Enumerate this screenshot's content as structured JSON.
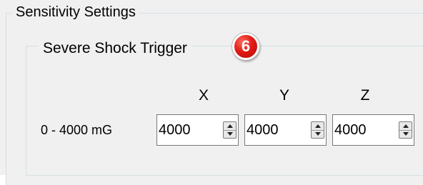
{
  "outer_group": {
    "title": "Sensitivity Settings"
  },
  "inner_group": {
    "title": "Severe Shock Trigger",
    "badge": "6"
  },
  "axes": [
    "X",
    "Y",
    "Z"
  ],
  "range_label": "0 - 4000 mG",
  "fields": [
    {
      "axis": "X",
      "value": "4000"
    },
    {
      "axis": "Y",
      "value": "4000"
    },
    {
      "axis": "Z",
      "value": "4000"
    }
  ],
  "colors": {
    "badge": "#e21b14",
    "frame": "#d5dfe5",
    "background": "#f0f0f0"
  }
}
